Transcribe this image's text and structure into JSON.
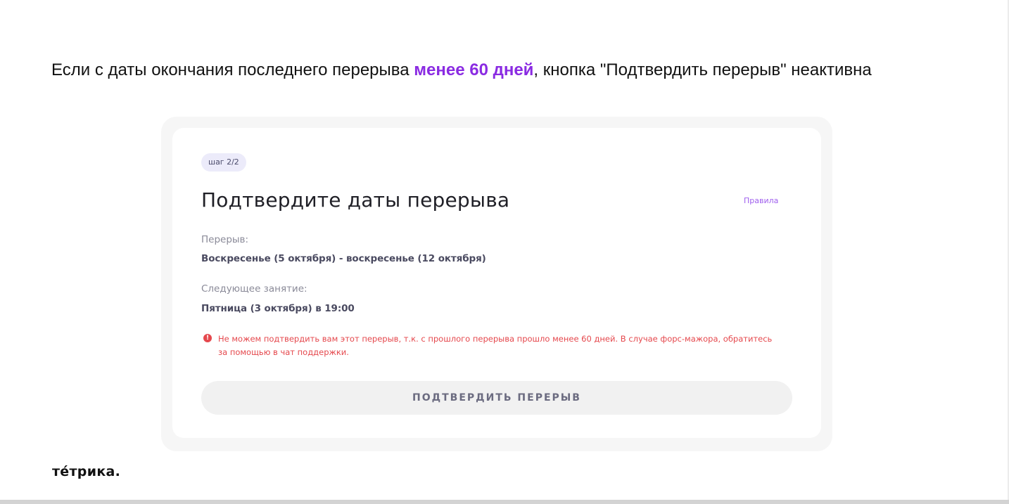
{
  "caption": {
    "before": "Если с даты окончания последнего перерыва ",
    "highlight": "менее 60 дней",
    "after": ", кнопка \"Подтвердить перерыв\" неактивна"
  },
  "dialog": {
    "step_badge": "шаг 2/2",
    "title": "Подтвердите даты перерыва",
    "rules_link": "Правила",
    "break_label": "Перерыв:",
    "break_value": "Воскресенье (5 октября) - воскресенье (12 октября)",
    "next_lesson_label": "Следующее занятие:",
    "next_lesson_value": "Пятница (3 октября) в 19:00",
    "error_icon_glyph": "!",
    "error_message": "Не можем подтвердить вам этот перерыв, т.к. с прошлого перерыва прошло менее 60 дней. В случае форс-мажора, обратитесь за помощью в чат поддержки.",
    "confirm_button": "ПОДТВЕРДИТЬ ПЕРЕРЫВ",
    "confirm_disabled": true
  },
  "logo": {
    "text": "тéтрика."
  },
  "colors": {
    "highlight": "#8a2be2",
    "link": "#a060ee",
    "error": "#e5484d",
    "badge_bg": "#ecebfa",
    "button_bg": "#f1f1f1",
    "button_text": "#6b6b80"
  }
}
